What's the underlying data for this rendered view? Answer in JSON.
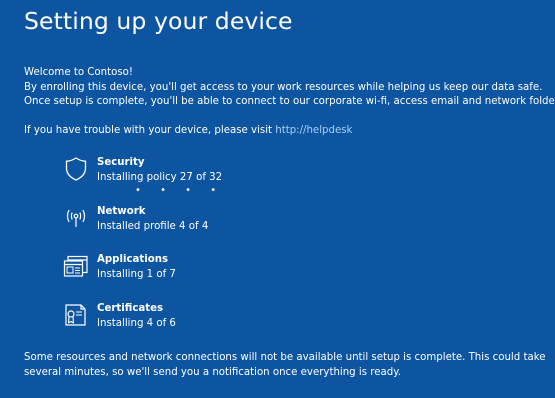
{
  "page": {
    "title": "Setting up your device",
    "accent_color": "#0d55a0"
  },
  "intro": {
    "line1": "Welcome to Contoso!",
    "line2": "By enrolling this device, you'll get access to your work resources while helping us keep our data safe.",
    "line3": "Once setup is complete, you'll be able to connect to our corporate wi-fi, access email and network folders."
  },
  "help": {
    "text": "If you have trouble with your device, please visit ",
    "link": "http://helpdesk",
    "link_color": "#a9cff3"
  },
  "steps": [
    {
      "icon": "shield-icon",
      "title": "Security",
      "status": "Installing policy 27 of 32"
    },
    {
      "icon": "network-icon",
      "title": "Network",
      "status": "Installed profile 4 of 4"
    },
    {
      "icon": "applications-icon",
      "title": "Applications",
      "status": "Installing 1 of 7"
    },
    {
      "icon": "certificate-icon",
      "title": "Certificates",
      "status": "Installing 4 of 6"
    }
  ],
  "progress_indicator": "• • • •",
  "footer": {
    "line1": "Some resources and network connections will not be available until setup is complete. This could take",
    "line2": "several minutes, so we'll send you a notification once everything is ready."
  }
}
